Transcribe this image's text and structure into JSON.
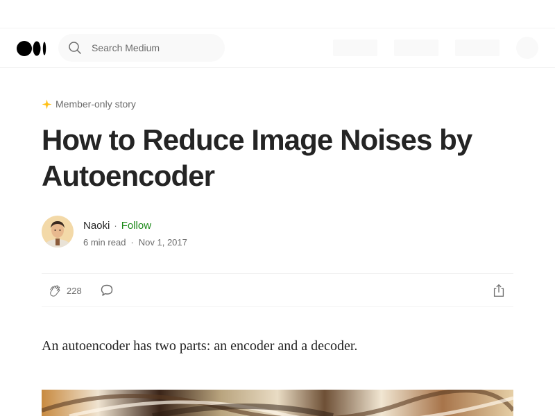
{
  "header": {
    "search": {
      "placeholder": "Search Medium",
      "icon": "search-icon"
    },
    "logo_icon": "medium-logo-icon"
  },
  "article": {
    "badge": {
      "icon": "star-icon",
      "label": "Member-only story",
      "color": "#ffc017"
    },
    "title": "How to Reduce Image Noises by Autoencoder",
    "author": {
      "name": "Naoki",
      "follow_label": "Follow",
      "follow_color": "#1a8917",
      "read_time": "6 min read",
      "date": "Nov 1, 2017"
    },
    "actions": {
      "clap_icon": "clap-icon",
      "clap_count": "228",
      "comment_icon": "comment-icon",
      "share_icon": "share-icon"
    },
    "body": "An autoencoder has two parts: an encoder and a decoder."
  }
}
